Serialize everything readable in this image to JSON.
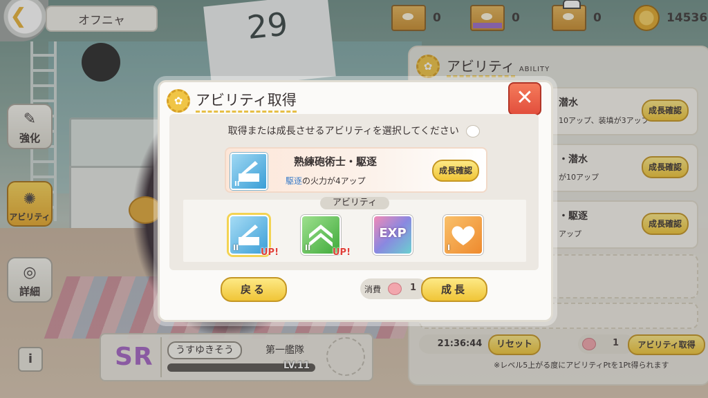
{
  "top_bar": {
    "character_name": "オフニャ",
    "resources": [
      {
        "icon": "box-icon",
        "value": "0"
      },
      {
        "icon": "purple-box-icon",
        "value": "0"
      },
      {
        "icon": "captain-box-icon",
        "value": "0"
      },
      {
        "icon": "gold-coin-icon",
        "value": "14536"
      }
    ]
  },
  "sidebar": {
    "items": [
      {
        "label": "強化",
        "icon": "enhance-icon"
      },
      {
        "label": "アビリティ",
        "icon": "paw-gear-icon"
      },
      {
        "label": "詳細",
        "icon": "detail-icon"
      }
    ],
    "info_label": "i"
  },
  "character_card": {
    "rarity": "SR",
    "ship_name": "うすゆきそう",
    "fleet": "第一艦隊",
    "level": "LV.11"
  },
  "right_panel": {
    "title": "アビリティ",
    "subtitle": "ABILITY",
    "rows": [
      {
        "title": "潜水",
        "desc": "10アップ、装填が3アップ",
        "button": "成長確認"
      },
      {
        "title": "・潜水",
        "desc": "が10アップ",
        "button": "成長確認"
      },
      {
        "title": "・駆逐",
        "desc": "アップ",
        "button": "成長確認"
      }
    ],
    "timer": "21:36:44",
    "reset_label": "リセット",
    "points": "1",
    "get_label": "アビリティ取得",
    "note": "※レベル5上がる度にアビリティPtを1Pt得られます"
  },
  "dialog": {
    "title": "アビリティ取得",
    "close_label": "✕",
    "instruction": "取得または成長させるアビリティを選択してください",
    "selected": {
      "name": "熟練砲術士・駆逐",
      "desc_highlight": "駆逐",
      "desc_rest": "の火力が4アップ",
      "level_mark": "II",
      "button": "成長確認"
    },
    "ability_section_label": "アビリティ",
    "abilities": [
      {
        "icon": "cannon-icon",
        "level": "II",
        "badge": "UP!",
        "color": "#4aa8e0",
        "selected": true
      },
      {
        "icon": "rank-up-icon",
        "level": "II",
        "badge": "UP!",
        "color": "#58c24b",
        "selected": false
      },
      {
        "icon": "exp-icon",
        "level": "",
        "badge": "",
        "text": "EXP",
        "color": "#c874c8",
        "selected": false
      },
      {
        "icon": "heart-icon",
        "level": "I",
        "badge": "",
        "color": "#f09a3a",
        "selected": false
      }
    ],
    "back_label": "戻る",
    "cost_label": "消費",
    "cost_value": "1",
    "grow_label": "成長"
  }
}
